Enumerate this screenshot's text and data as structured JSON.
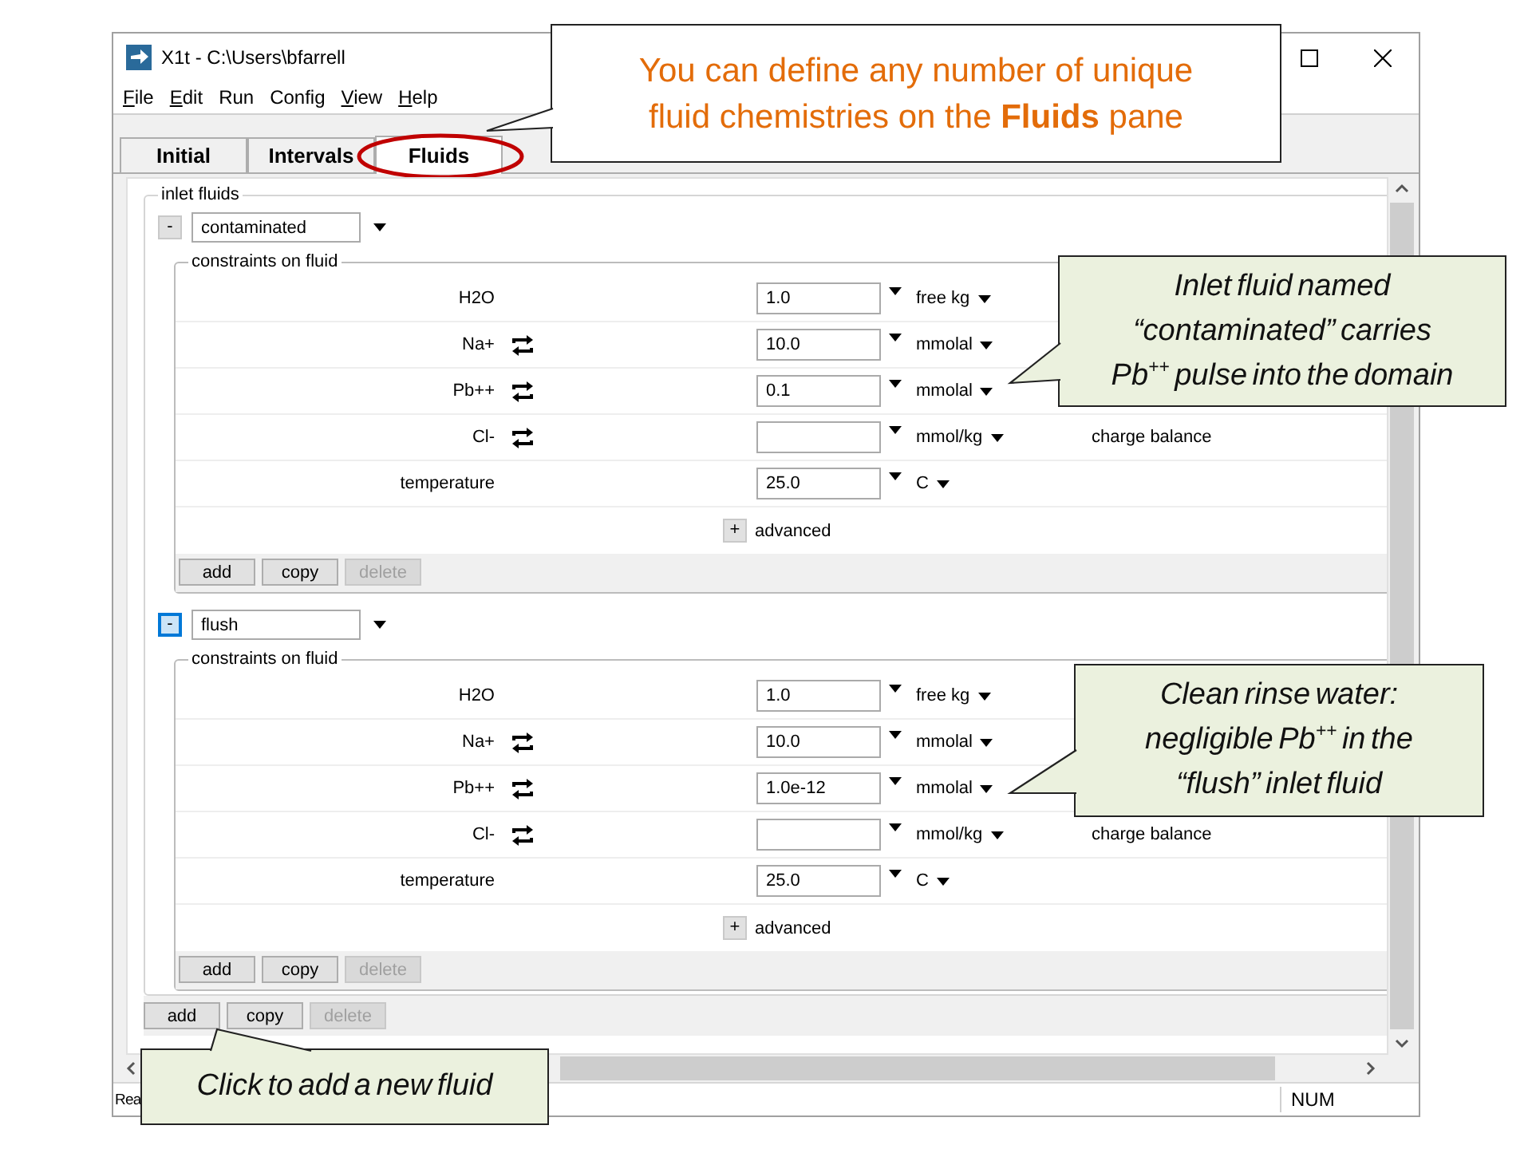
{
  "window": {
    "title": "X1t - C:\\Users\\bfarrell"
  },
  "menu": [
    {
      "label": "File",
      "underline_first": true
    },
    {
      "label": "Edit",
      "underline_first": true
    },
    {
      "label": "Run",
      "underline_first": false
    },
    {
      "label": "Config",
      "underline_first": false
    },
    {
      "label": "View",
      "underline_first": true
    },
    {
      "label": "Help",
      "underline_first": true
    }
  ],
  "tabs": [
    {
      "label": "Initial",
      "selected": false,
      "circled": false
    },
    {
      "label": "Intervals",
      "selected": false,
      "circled": false
    },
    {
      "label": "Fluids",
      "selected": true,
      "circled": true
    }
  ],
  "inlet_fluids": {
    "title": "inlet fluids",
    "fluids": [
      {
        "toggle": "-",
        "focused": false,
        "name": "contaminated",
        "constraints": {
          "title": "constraints on fluid",
          "rows": [
            {
              "species": "H2O",
              "swap": false,
              "value": "1.0",
              "unit": "free kg"
            },
            {
              "species": "Na+",
              "swap": true,
              "value": "10.0",
              "unit": "mmolal"
            },
            {
              "species": "Pb++",
              "swap": true,
              "value": "0.1",
              "unit": "mmolal"
            },
            {
              "species": "Cl-",
              "swap": true,
              "unit": "mmol/kg",
              "note": "charge balance"
            },
            {
              "species": "temperature",
              "swap": false,
              "value": "25.0",
              "unit": "C"
            }
          ],
          "advanced": {
            "toggle": "+",
            "label": "advanced"
          },
          "buttons": [
            {
              "label": "add",
              "disabled": false
            },
            {
              "label": "copy",
              "disabled": false
            },
            {
              "label": "delete",
              "disabled": true
            }
          ]
        }
      },
      {
        "toggle": "-",
        "focused": true,
        "name": "flush",
        "constraints": {
          "title": "constraints on fluid",
          "rows": [
            {
              "species": "H2O",
              "swap": false,
              "value": "1.0",
              "unit": "free kg"
            },
            {
              "species": "Na+",
              "swap": true,
              "value": "10.0",
              "unit": "mmolal"
            },
            {
              "species": "Pb++",
              "swap": true,
              "value": "1.0e-12",
              "unit": "mmolal"
            },
            {
              "species": "Cl-",
              "swap": true,
              "unit": "mmol/kg",
              "note": "charge balance"
            },
            {
              "species": "temperature",
              "swap": false,
              "value": "25.0",
              "unit": "C"
            }
          ],
          "advanced": {
            "toggle": "+",
            "label": "advanced"
          },
          "buttons": [
            {
              "label": "add",
              "disabled": false
            },
            {
              "label": "copy",
              "disabled": false
            },
            {
              "label": "delete",
              "disabled": true
            }
          ]
        }
      }
    ],
    "buttons": [
      {
        "label": "add",
        "disabled": false
      },
      {
        "label": "copy",
        "disabled": false
      },
      {
        "label": "delete",
        "disabled": true
      }
    ]
  },
  "status_bar": {
    "text": "Rea",
    "indicators": [
      "NUM"
    ]
  },
  "callouts": [
    {
      "kind": "plain",
      "text": "You can define any number of unique fluid chemistries on the **Fluids** pane"
    },
    {
      "kind": "note",
      "text": "Inlet fluid named “contaminated” carries Pb$^{++}$ pulse into the domain"
    },
    {
      "kind": "note",
      "text": "Clean rinse water: negligible Pb$^{++}$ in the “flush” inlet fluid"
    },
    {
      "kind": "note",
      "text": "Click to add a new fluid"
    }
  ]
}
